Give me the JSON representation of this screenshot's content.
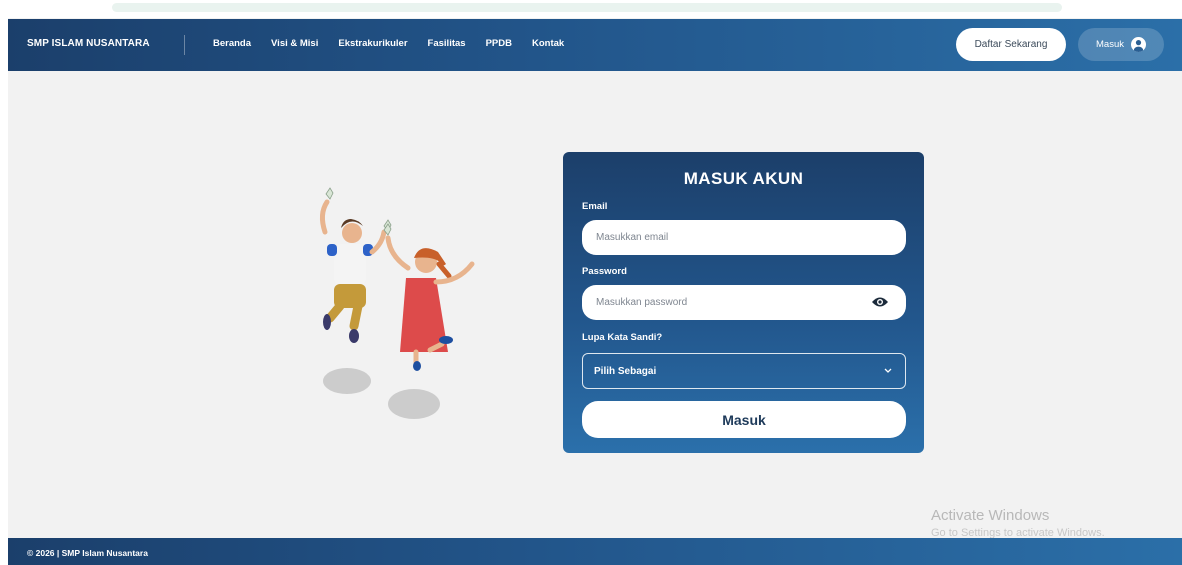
{
  "navbar": {
    "brand": "SMP ISLAM NUSANTARA",
    "links": [
      "Beranda",
      "Visi & Misi",
      "Ekstrakurikuler",
      "Fasilitas",
      "PPDB",
      "Kontak"
    ],
    "register_button": "Daftar Sekarang",
    "login_button": "Masuk",
    "login_icon": "user-circle-icon"
  },
  "login": {
    "title": "MASUK AKUN",
    "email_label": "Email",
    "email_placeholder": "Masukkan email",
    "email_value": "",
    "password_label": "Password",
    "password_placeholder": "Masukkan password",
    "password_value": "",
    "show_password_icon": "eye-icon",
    "forgot_link": "Lupa Kata Sandi?",
    "role_select_value": "Pilih Sebagai",
    "role_select_icon": "chevron-down-icon",
    "submit_button": "Masuk"
  },
  "illustration": "jumping-kids-illustration",
  "watermark": {
    "line1": "Activate Windows",
    "line2": "Go to Settings to activate Windows."
  },
  "footer": {
    "text": "© 2026 | SMP Islam Nusantara"
  },
  "colors": {
    "primary_dark": "#1b3f6b",
    "primary_light": "#2b6fa8",
    "background": "#f2f2f2",
    "white": "#ffffff"
  }
}
